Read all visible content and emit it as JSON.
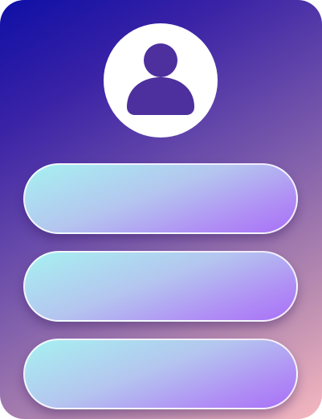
{
  "profile": {
    "avatar_icon": "user-icon",
    "avatar_icon_color": "#4d2f9d",
    "avatar_background": "#ffffff"
  },
  "menu": {
    "buttons": [
      {
        "label": ""
      },
      {
        "label": ""
      },
      {
        "label": ""
      }
    ]
  },
  "colors": {
    "gradient_start": "#0e0fa6",
    "gradient_mid": "#7a5aab",
    "gradient_end": "#f6b8c0",
    "button_start": "#a6f1f1",
    "button_end": "#a870f6"
  }
}
